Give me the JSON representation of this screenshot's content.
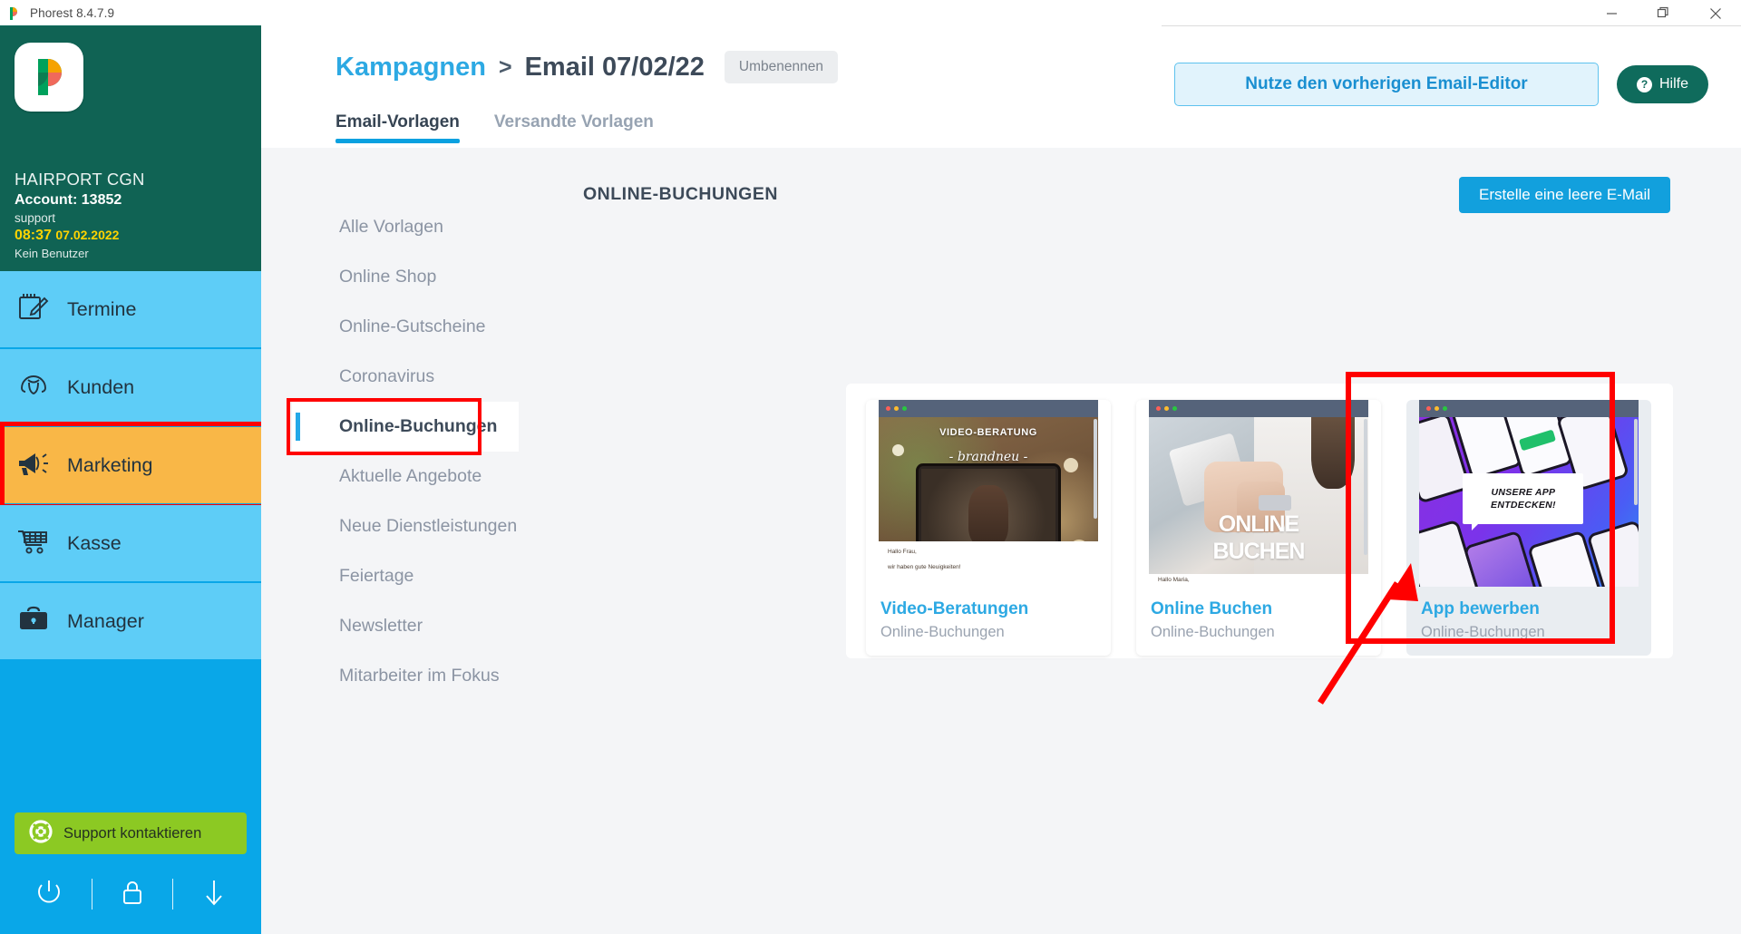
{
  "window": {
    "app_title": "Phorest 8.4.7.9",
    "buttons": [
      {
        "name": "minimize",
        "glyph": "—"
      },
      {
        "name": "maximize",
        "glyph": "❐"
      },
      {
        "name": "close",
        "glyph": "✕"
      }
    ]
  },
  "sidebar": {
    "brand": {
      "salon_name": "HAIRPORT CGN",
      "account_label": "Account: 13852",
      "user": "support",
      "time": "08:37",
      "date": "07.02.2022",
      "no_user": "Kein Benutzer"
    },
    "nav_items": [
      {
        "label": "Termine",
        "icon": "calendar-edit-icon",
        "active": false
      },
      {
        "label": "Kunden",
        "icon": "client-icon",
        "active": false
      },
      {
        "label": "Marketing",
        "icon": "megaphone-icon",
        "active": true
      },
      {
        "label": "Kasse",
        "icon": "shopping-cart-icon",
        "active": false
      },
      {
        "label": "Manager",
        "icon": "briefcase-icon",
        "active": false
      }
    ],
    "support_button": {
      "label": "Support kontaktieren",
      "icon": "lifebuoy-icon"
    },
    "bottom_icons": [
      {
        "name": "power-icon"
      },
      {
        "name": "lock-icon"
      },
      {
        "name": "download-arrow-icon"
      }
    ]
  },
  "header": {
    "breadcrumb_root": "Kampagnen",
    "breadcrumb_separator": ">",
    "breadcrumb_current": "Email 07/02/22",
    "rename_label": "Umbenennen",
    "prev_editor_label": "Nutze den vorherigen Email-Editor",
    "help_label": "Hilfe",
    "tabs": [
      {
        "label": "Email-Vorlagen",
        "active": true
      },
      {
        "label": "Versandte Vorlagen",
        "active": false
      }
    ]
  },
  "categories": [
    {
      "label": "Alle Vorlagen",
      "active": false
    },
    {
      "label": "Online Shop",
      "active": false
    },
    {
      "label": "Online-Gutscheine",
      "active": false
    },
    {
      "label": "Coronavirus",
      "active": false
    },
    {
      "label": "Online-Buchungen",
      "active": true
    },
    {
      "label": "Aktuelle Angebote",
      "active": false
    },
    {
      "label": "Neue Dienstleistungen",
      "active": false
    },
    {
      "label": "Feiertage",
      "active": false
    },
    {
      "label": "Newsletter",
      "active": false
    },
    {
      "label": "Mitarbeiter im Fokus",
      "active": false
    }
  ],
  "templates_section": {
    "title": "ONLINE-BUCHUNGEN",
    "create_empty_label": "Erstelle eine leere E-Mail",
    "cards": [
      {
        "name": "Video-Beratungen",
        "category": "Online-Buchungen",
        "preview_headline": "VIDEO-BERATUNG",
        "preview_sub": "- brandneu -",
        "body_line1": "Hallo Frau,",
        "body_line2": "wir haben gute Neuigkeiten!",
        "selected": false
      },
      {
        "name": "Online Buchen",
        "category": "Online-Buchungen",
        "preview_headline": "ONLINE",
        "preview_sub": "BUCHEN",
        "body_line1": "Hallo Maria,",
        "body_line2": "",
        "selected": false
      },
      {
        "name": "App bewerben",
        "category": "Online-Buchungen",
        "preview_headline": "UNSERE APP",
        "preview_sub": "ENTDECKEN!",
        "body_line1": "",
        "body_line2": "",
        "selected": true
      }
    ]
  },
  "annotations": {
    "highlight_color": "#ff0000",
    "marketing_box": "Marketing sidebar item highlighted",
    "category_box": "Online-Buchungen category highlighted",
    "card_box": "App bewerben card highlighted",
    "arrow": "red arrow pointing at App bewerben card"
  },
  "colors": {
    "brand_teal": "#106354",
    "sidebar_blue": "#09a7e8",
    "nav_blue": "#5ecdf7",
    "active_orange": "#f9b747",
    "accent_blue": "#2da9e3",
    "support_green": "#8cc923",
    "highlight_red": "#ff0000"
  }
}
